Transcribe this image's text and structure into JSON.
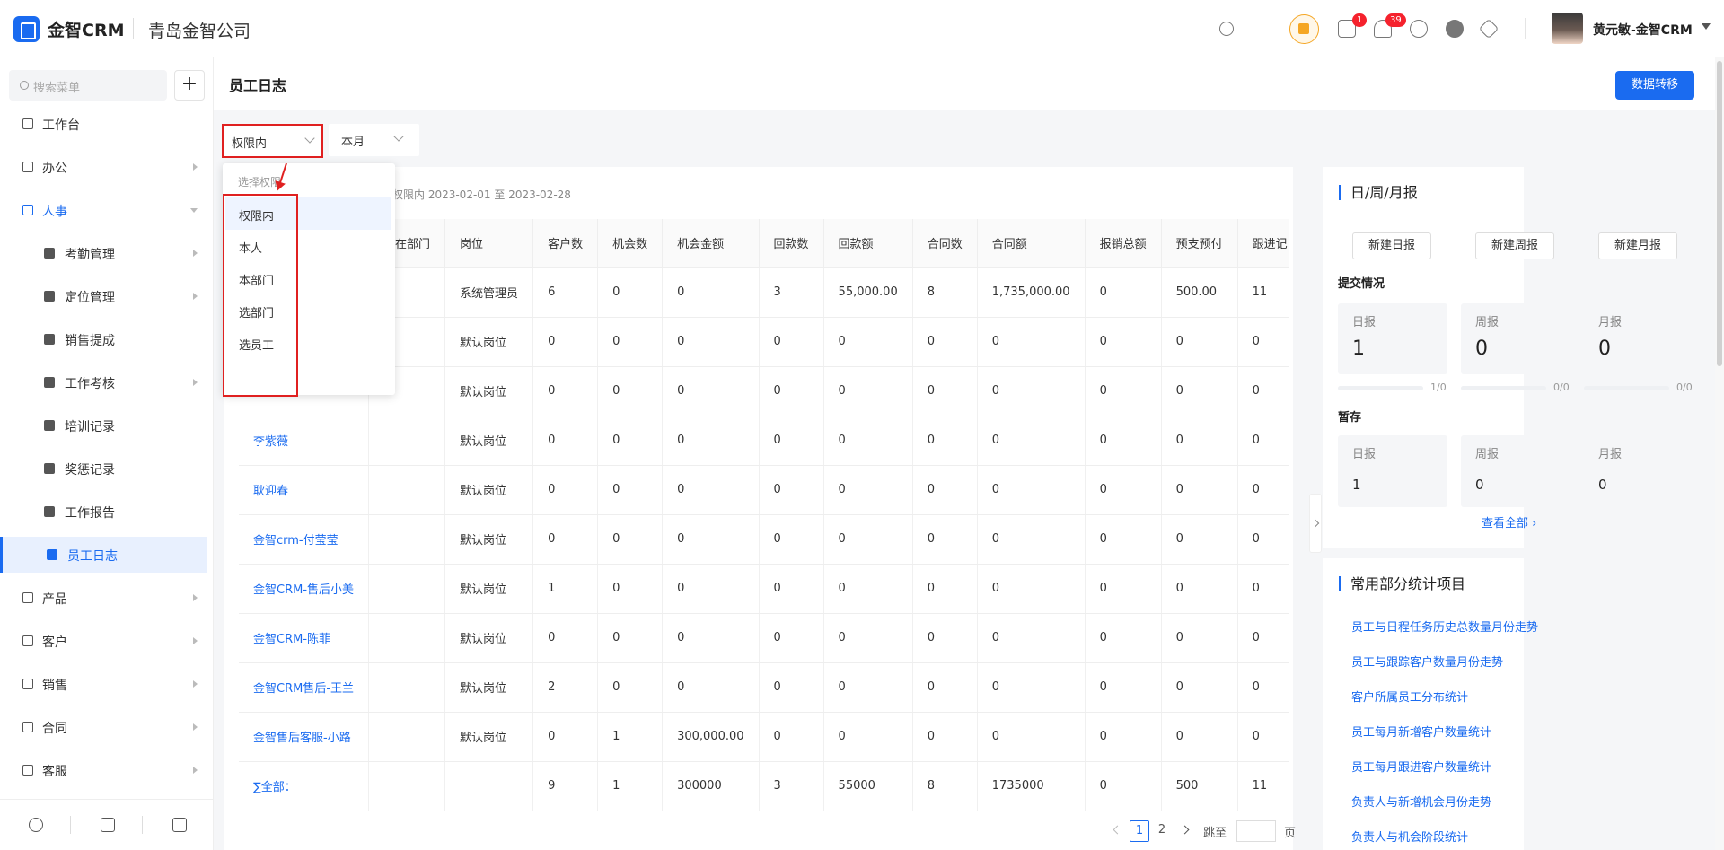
{
  "header": {
    "logo_text": "金智CRM",
    "company": "青岛金智公司",
    "badges": {
      "messages": "1",
      "notifications": "39"
    },
    "user": "黄元敏-金智CRM"
  },
  "sidebar": {
    "search_placeholder": "搜索菜单",
    "add": "+",
    "items": [
      {
        "label": "工作台"
      },
      {
        "label": "办公"
      },
      {
        "label": "人事"
      },
      {
        "label": "考勤管理"
      },
      {
        "label": "定位管理"
      },
      {
        "label": "销售提成"
      },
      {
        "label": "工作考核"
      },
      {
        "label": "培训记录"
      },
      {
        "label": "奖惩记录"
      },
      {
        "label": "工作报告"
      },
      {
        "label": "员工日志"
      },
      {
        "label": "产品"
      },
      {
        "label": "客户"
      },
      {
        "label": "销售"
      },
      {
        "label": "合同"
      },
      {
        "label": "客服"
      }
    ]
  },
  "page": {
    "title": "员工日志",
    "transfer_button": "数据转移",
    "filter_scope": "权限内",
    "filter_period": "本月",
    "range_text": "权限内 2023-02-01 至 2023-02-28"
  },
  "dropdown": {
    "header": "选择权限",
    "options": [
      "权限内",
      "本人",
      "本部门",
      "选部门",
      "选员工"
    ]
  },
  "table": {
    "columns": [
      "",
      "所在部门",
      "岗位",
      "客户数",
      "机会数",
      "机会金额",
      "回款数",
      "回款额",
      "合同数",
      "合同额",
      "报销总额",
      "预支预付",
      "跟进记"
    ],
    "rows": [
      [
        "",
        "",
        "系统管理员",
        "6",
        "0",
        "0",
        "3",
        "55,000.00",
        "8",
        "1,735,000.00",
        "0",
        "500.00",
        "11"
      ],
      [
        "",
        "",
        "默认岗位",
        "0",
        "0",
        "0",
        "0",
        "0",
        "0",
        "0",
        "0",
        "0",
        "0"
      ],
      [
        "",
        "",
        "默认岗位",
        "0",
        "0",
        "0",
        "0",
        "0",
        "0",
        "0",
        "0",
        "0",
        "0"
      ],
      [
        "李紫薇",
        "",
        "默认岗位",
        "0",
        "0",
        "0",
        "0",
        "0",
        "0",
        "0",
        "0",
        "0",
        "0"
      ],
      [
        "耿迎春",
        "",
        "默认岗位",
        "0",
        "0",
        "0",
        "0",
        "0",
        "0",
        "0",
        "0",
        "0",
        "0"
      ],
      [
        "金智crm-付莹莹",
        "",
        "默认岗位",
        "0",
        "0",
        "0",
        "0",
        "0",
        "0",
        "0",
        "0",
        "0",
        "0"
      ],
      [
        "金智CRM-售后小美",
        "",
        "默认岗位",
        "1",
        "0",
        "0",
        "0",
        "0",
        "0",
        "0",
        "0",
        "0",
        "0"
      ],
      [
        "金智CRM-陈菲",
        "",
        "默认岗位",
        "0",
        "0",
        "0",
        "0",
        "0",
        "0",
        "0",
        "0",
        "0",
        "0"
      ],
      [
        "金智CRM售后-王兰",
        "",
        "默认岗位",
        "2",
        "0",
        "0",
        "0",
        "0",
        "0",
        "0",
        "0",
        "0",
        "0"
      ],
      [
        "金智售后客服-小路",
        "",
        "默认岗位",
        "0",
        "1",
        "300,000.00",
        "0",
        "0",
        "0",
        "0",
        "0",
        "0",
        "0"
      ],
      [
        "∑全部：",
        "",
        "",
        "9",
        "1",
        "300000",
        "3",
        "55000",
        "8",
        "1735000",
        "0",
        "500",
        "11"
      ]
    ]
  },
  "pager": {
    "current": "1",
    "next": "2",
    "jump": "跳至",
    "unit": "页"
  },
  "reports": {
    "title": "日/周/月报",
    "buttons": [
      "新建日报",
      "新建周报",
      "新建月报"
    ],
    "submit_title": "提交情况",
    "submit": [
      {
        "label": "日报",
        "value": "1",
        "ratio": "1/0"
      },
      {
        "label": "周报",
        "value": "0",
        "ratio": "0/0"
      },
      {
        "label": "月报",
        "value": "0",
        "ratio": "0/0"
      }
    ],
    "draft_title": "暂存",
    "draft": [
      {
        "label": "日报",
        "value": "1"
      },
      {
        "label": "周报",
        "value": "0"
      },
      {
        "label": "月报",
        "value": "0"
      }
    ],
    "view_all": "查看全部 ›"
  },
  "stats": {
    "title": "常用部分统计项目",
    "links": [
      "员工与日程任务历史总数量月份走势",
      "员工与跟踪客户数量月份走势",
      "客户所属员工分布统计",
      "员工每月新增客户数量统计",
      "员工每月跟进客户数量统计",
      "负责人与新增机会月份走势",
      "负责人与机会阶段统计"
    ]
  }
}
